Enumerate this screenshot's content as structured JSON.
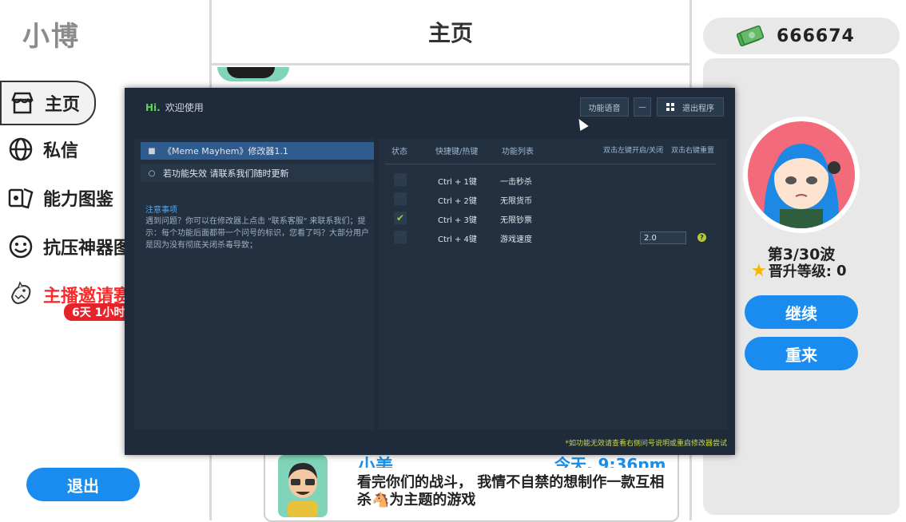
{
  "sidebar": {
    "brand": "小博",
    "items": [
      {
        "label": "主页",
        "icon": "store-icon"
      },
      {
        "label": "私信",
        "icon": "globe-icon"
      },
      {
        "label": "能力图鉴",
        "icon": "cards-icon"
      },
      {
        "label": "抗压神器图",
        "icon": "smiley-icon"
      },
      {
        "label": "主播邀请赛",
        "icon": "shark-icon"
      }
    ],
    "invite_badge": "6天 1小时",
    "exit_label": "退出"
  },
  "header": {
    "title": "主页"
  },
  "message": {
    "name": "小美",
    "time": "今天, 9:36pm",
    "text": "看完你们的战斗， 我情不自禁的想制作一款互相杀🐴为主题的游戏"
  },
  "right": {
    "money": "666674",
    "wave": "第3/30波",
    "level_label": "晋升等级:",
    "level_value": "0",
    "continue_label": "继续",
    "restart_label": "重来"
  },
  "trainer": {
    "greeting": "Hi.",
    "title": "欢迎使用",
    "buttons": {
      "voice": "功能语音",
      "minimize": "—",
      "exit": "退出程序"
    },
    "left_items": [
      {
        "label": "《Meme Mayhem》修改器1.1",
        "icon": "user-icon",
        "selected": true
      },
      {
        "label": "若功能失效 请联系我们随时更新",
        "icon": "gear-icon",
        "selected": false
      }
    ],
    "notice_head": "注意事项",
    "notice_text": "遇到问题？你可以在修改器上点击 \"联系客服\" 来联系我们；提示：每个功能后面都带一个问号的标识，您看了吗？大部分用户是因为没有彻底关闭杀毒导致；",
    "columns": {
      "status": "状态",
      "hotkey": "快捷键/热键",
      "function": "功能列表",
      "toggle_hint": "双击左键开启/关闭",
      "reset_hint": "双击右键重置"
    },
    "rows": [
      {
        "checked": false,
        "key": "Ctrl + 1键",
        "func": "一击秒杀"
      },
      {
        "checked": false,
        "key": "Ctrl + 2键",
        "func": "无限货币"
      },
      {
        "checked": true,
        "key": "Ctrl + 3键",
        "func": "无限钞票"
      },
      {
        "checked": false,
        "key": "Ctrl + 4键",
        "func": "游戏速度"
      }
    ],
    "speed_value": "2.0",
    "help_mark": "?",
    "footer": "*如功能无效请查看右侧问号说明或重启修改器尝试"
  }
}
